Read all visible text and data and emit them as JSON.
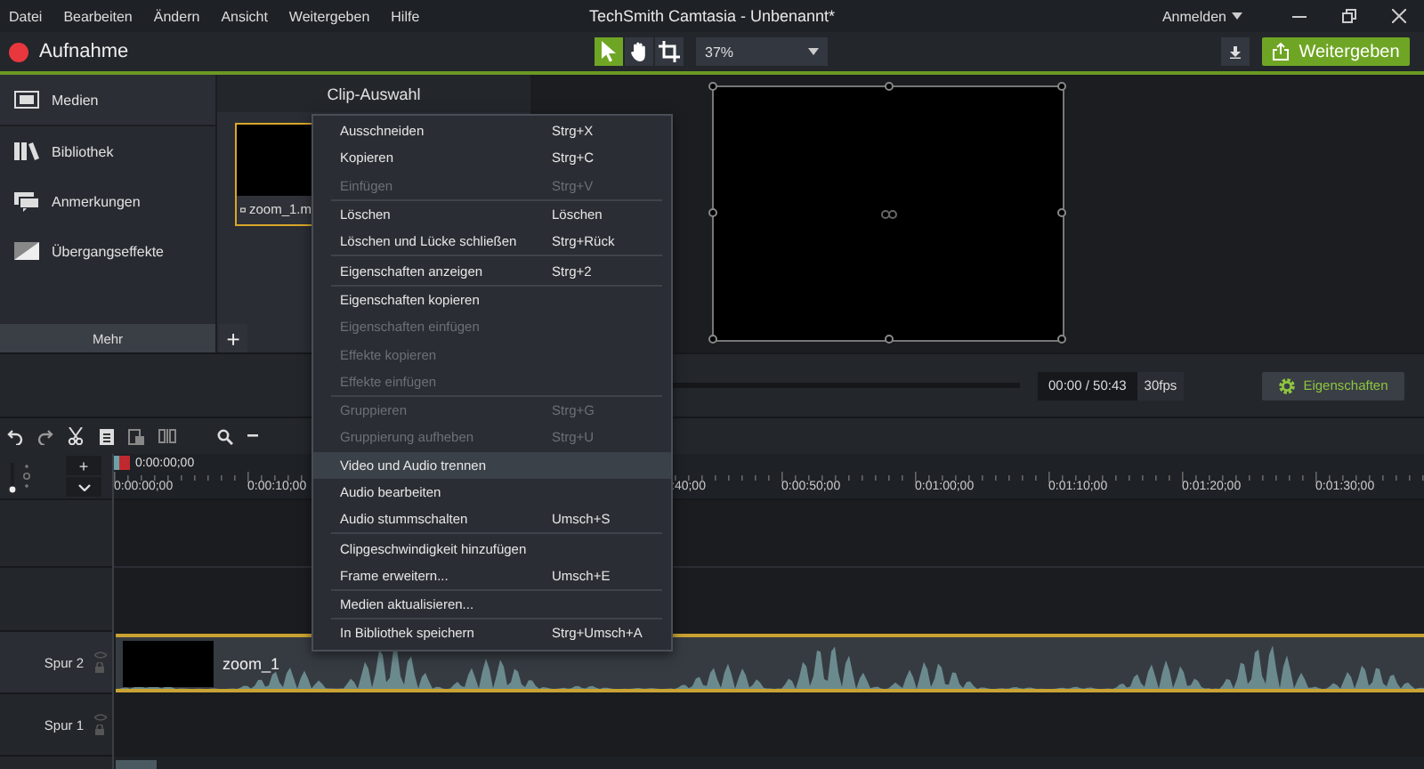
{
  "menubar": {
    "items": [
      "Datei",
      "Bearbeiten",
      "Ändern",
      "Ansicht",
      "Weitergeben",
      "Hilfe"
    ],
    "title": "TechSmith Camtasia - Unbenannt*",
    "account": "Anmelden"
  },
  "toolbar": {
    "record_label": "Aufnahme",
    "tools": [
      {
        "kind": "pointer",
        "selected": true
      },
      {
        "kind": "hand",
        "selected": false
      },
      {
        "kind": "crop",
        "selected": false
      }
    ],
    "zoom": "37%",
    "share_label": "Weitergeben"
  },
  "sidebar": {
    "items": [
      {
        "kind": "media",
        "label": "Medien",
        "selected": true
      },
      {
        "kind": "library",
        "label": "Bibliothek",
        "selected": false
      },
      {
        "kind": "annotations",
        "label": "Anmerkungen",
        "selected": false
      },
      {
        "kind": "transitions",
        "label": "Übergangseffekte",
        "selected": false
      }
    ],
    "more_label": "Mehr",
    "add_label": "+"
  },
  "clip_panel": {
    "title": "Clip-Auswahl",
    "clip": {
      "label": "zoom_1.m",
      "selected": true
    }
  },
  "playback": {
    "time": "00:00 / 50:43",
    "fps": "30fps",
    "properties_label": "Eigenschaften"
  },
  "timeline": {
    "playhead_time": "0:00:00;00",
    "add_label": "+",
    "ruler_labels": [
      "0:00:00;00",
      "0:00:10;00",
      ":40;00",
      "0:00:50;00",
      "0:01:00;00",
      "0:01:10;00",
      "0:01:20;00",
      "0:01:30;00"
    ],
    "tracks": [
      {
        "name": "Spur 2",
        "clip": {
          "label": "zoom_1",
          "selected": true
        }
      },
      {
        "name": "Spur 1"
      }
    ]
  },
  "context_menu": [
    {
      "kind": "item",
      "label": "Ausschneiden",
      "shortcut": "Strg+X",
      "disabled": false,
      "selected": false
    },
    {
      "kind": "item",
      "label": "Kopieren",
      "shortcut": "Strg+C",
      "disabled": false,
      "selected": false
    },
    {
      "kind": "item",
      "label": "Einfügen",
      "shortcut": "Strg+V",
      "disabled": true,
      "selected": false
    },
    {
      "kind": "separator"
    },
    {
      "kind": "item",
      "label": "Löschen",
      "shortcut": "Löschen",
      "disabled": false,
      "selected": false
    },
    {
      "kind": "item",
      "label": "Löschen und Lücke schließen",
      "shortcut": "Strg+Rück",
      "disabled": false,
      "selected": false
    },
    {
      "kind": "separator"
    },
    {
      "kind": "item",
      "label": "Eigenschaften anzeigen",
      "shortcut": "Strg+2",
      "disabled": false,
      "selected": false
    },
    {
      "kind": "separator"
    },
    {
      "kind": "item",
      "label": "Eigenschaften kopieren",
      "disabled": false,
      "selected": false
    },
    {
      "kind": "item",
      "label": "Eigenschaften einfügen",
      "disabled": true,
      "selected": false
    },
    {
      "kind": "item",
      "label": "Effekte kopieren",
      "disabled": true,
      "selected": false
    },
    {
      "kind": "item",
      "label": "Effekte einfügen",
      "disabled": true,
      "selected": false
    },
    {
      "kind": "separator"
    },
    {
      "kind": "item",
      "label": "Gruppieren",
      "shortcut": "Strg+G",
      "disabled": true,
      "selected": false
    },
    {
      "kind": "item",
      "label": "Gruppierung aufheben",
      "shortcut": "Strg+U",
      "disabled": true,
      "selected": false
    },
    {
      "kind": "item",
      "label": "Video und Audio trennen",
      "disabled": false,
      "selected": true
    },
    {
      "kind": "item",
      "label": "Audio bearbeiten",
      "disabled": false,
      "selected": false
    },
    {
      "kind": "item",
      "label": "Audio stummschalten",
      "shortcut": "Umsch+S",
      "disabled": false,
      "selected": false
    },
    {
      "kind": "separator"
    },
    {
      "kind": "item",
      "label": "Clipgeschwindigkeit hinzufügen",
      "disabled": false,
      "selected": false
    },
    {
      "kind": "item",
      "label": "Frame erweitern...",
      "shortcut": "Umsch+E",
      "disabled": false,
      "selected": false
    },
    {
      "kind": "separator"
    },
    {
      "kind": "item",
      "label": "Medien aktualisieren...",
      "disabled": false,
      "selected": false
    },
    {
      "kind": "separator"
    },
    {
      "kind": "item",
      "label": "In Bibliothek speichern",
      "shortcut": "Strg+Umsch+A",
      "disabled": false,
      "selected": false
    }
  ]
}
